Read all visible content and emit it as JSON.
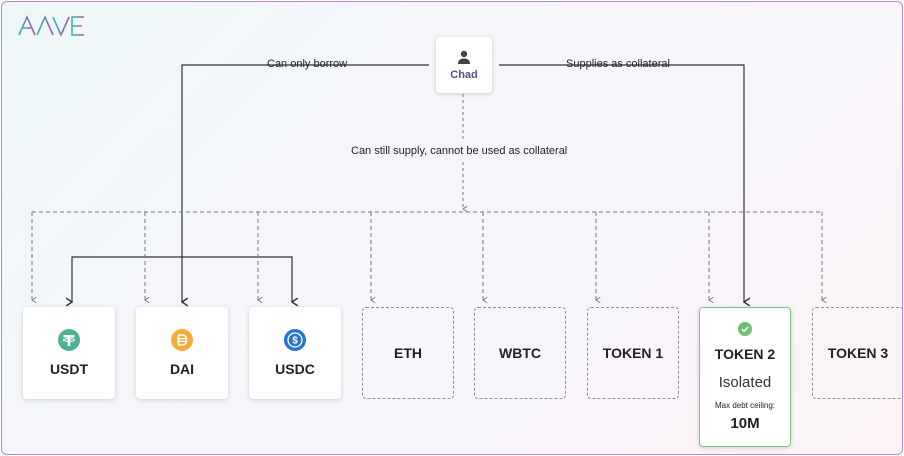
{
  "brand": {
    "logo_text": "AAVE"
  },
  "user": {
    "name": "Chad"
  },
  "labels": {
    "borrow": "Can only borrow",
    "collateral": "Supplies as collateral",
    "supply": "Can still supply, cannot be used as collateral"
  },
  "tokens": [
    {
      "name": "USDT",
      "icon": "tether-icon",
      "color": "#50af95"
    },
    {
      "name": "DAI",
      "icon": "dai-icon",
      "color": "#f5ac37"
    },
    {
      "name": "USDC",
      "icon": "usdc-icon",
      "color": "#2775ca"
    },
    {
      "name": "ETH"
    },
    {
      "name": "WBTC"
    },
    {
      "name": "TOKEN 1"
    },
    {
      "name": "TOKEN 2",
      "status": "Isolated",
      "debt_ceiling_label": "Max debt ceiling:",
      "debt_ceiling_value": "10M",
      "icon": "check-circle-icon",
      "color": "#6cc070"
    },
    {
      "name": "TOKEN 3"
    }
  ]
}
